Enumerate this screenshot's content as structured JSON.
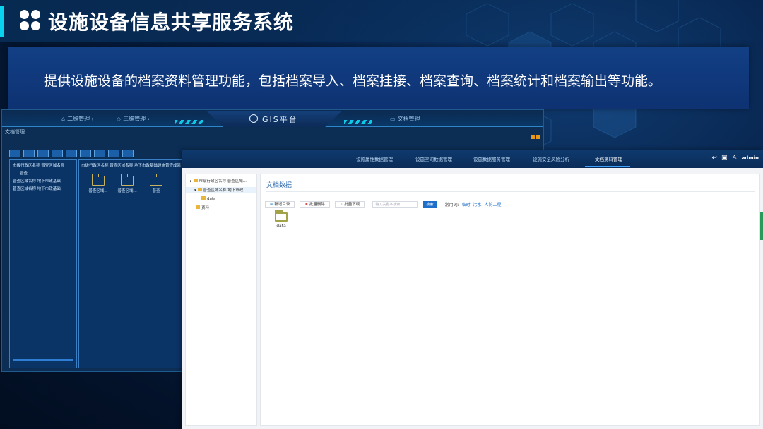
{
  "slide": {
    "title": "设施设备信息共享服务系统",
    "description": "提供设施设备的档案资料管理功能，包括档案导入、档案挂接、档案查询、档案统计和档案输出等功能。"
  },
  "gis": {
    "nav_left": [
      "二维管理",
      "三维管理"
    ],
    "platform_title": "GIS平台",
    "nav_right": [
      "文档管理"
    ],
    "window_title": "文档管理",
    "toolbar_buttons": [
      "",
      "",
      "",
      "",
      "",
      "",
      "",
      "",
      ""
    ],
    "tree": [
      "市级行政区名称 普查区域名称",
      "普查",
      "普查区域名称 地下市政基础",
      "普查区域名称 地下市政基础"
    ],
    "path": "市级行政区名称 普查区域名称 地下市政基础设施普查成果",
    "folders": [
      "普查区域...",
      "普查区域...",
      "普查"
    ]
  },
  "doc": {
    "nav": [
      "设施属性数据管理",
      "设施空间数据管理",
      "设施数据服务管理",
      "设施安全风险分析",
      "文档资料管理"
    ],
    "active_nav": "文档资料管理",
    "user": "admin",
    "tree": [
      "市级行政区名称 普查区域...",
      "普查区域名称 地下市政...",
      "data",
      "资料"
    ],
    "section_title": "文档数据",
    "buttons": {
      "new_dir": "新增目录",
      "batch_delete": "批量删除",
      "batch_download": "批量下载"
    },
    "search_placeholder": "输入关键字搜索",
    "search_button": "搜索",
    "common_label": "常用词:",
    "common_words": [
      "临时",
      "污水",
      "人防工程"
    ],
    "files": [
      "data"
    ]
  },
  "colors": {
    "accent_cyan": "#0ad3f0",
    "banner_blue": "#123f85",
    "doc_primary": "#1e6fc9",
    "folder_olive": "#a3a247"
  }
}
